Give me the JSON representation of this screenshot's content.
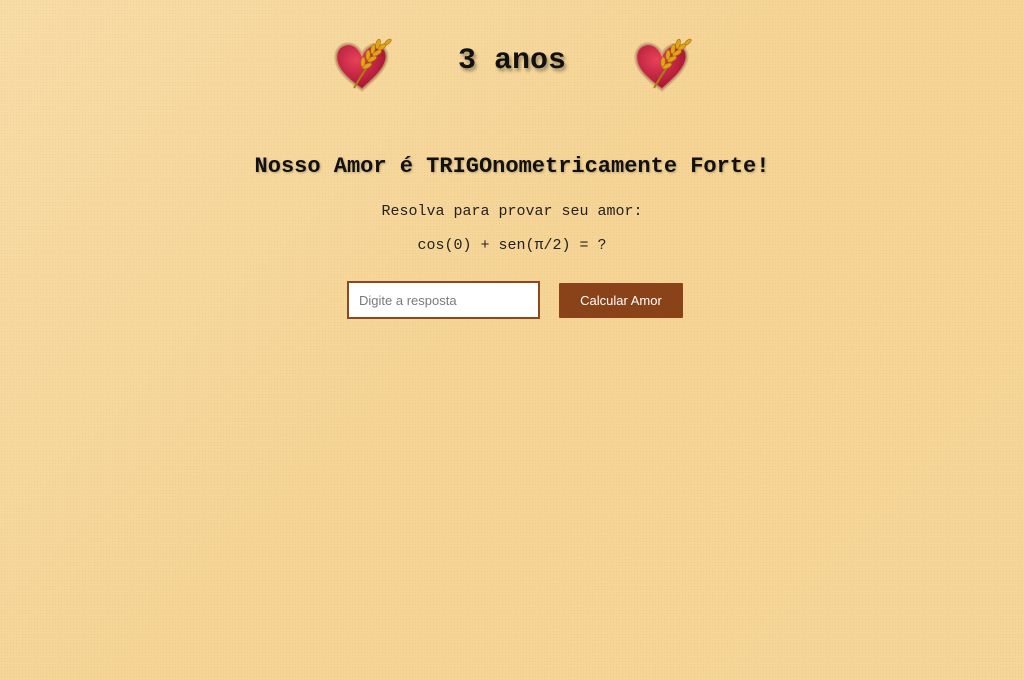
{
  "header": {
    "title": "3 anos",
    "left_icon": "heart-wheat-icon",
    "right_icon": "heart-wheat-icon"
  },
  "main": {
    "headline": "Nosso Amor é TRIGOnometricamente Forte!",
    "instruction": "Resolva para provar seu amor:",
    "equation": "cos(0) + sen(π/2) = ?"
  },
  "form": {
    "answer_placeholder": "Digite a resposta",
    "answer_value": "",
    "button_label": "Calcular Amor"
  },
  "colors": {
    "background": "#f6d79b",
    "button_bg": "#8a4218",
    "input_border": "#8a4a1d",
    "heart_red": "#c8183a",
    "wheat_gold": "#e3a21a"
  }
}
